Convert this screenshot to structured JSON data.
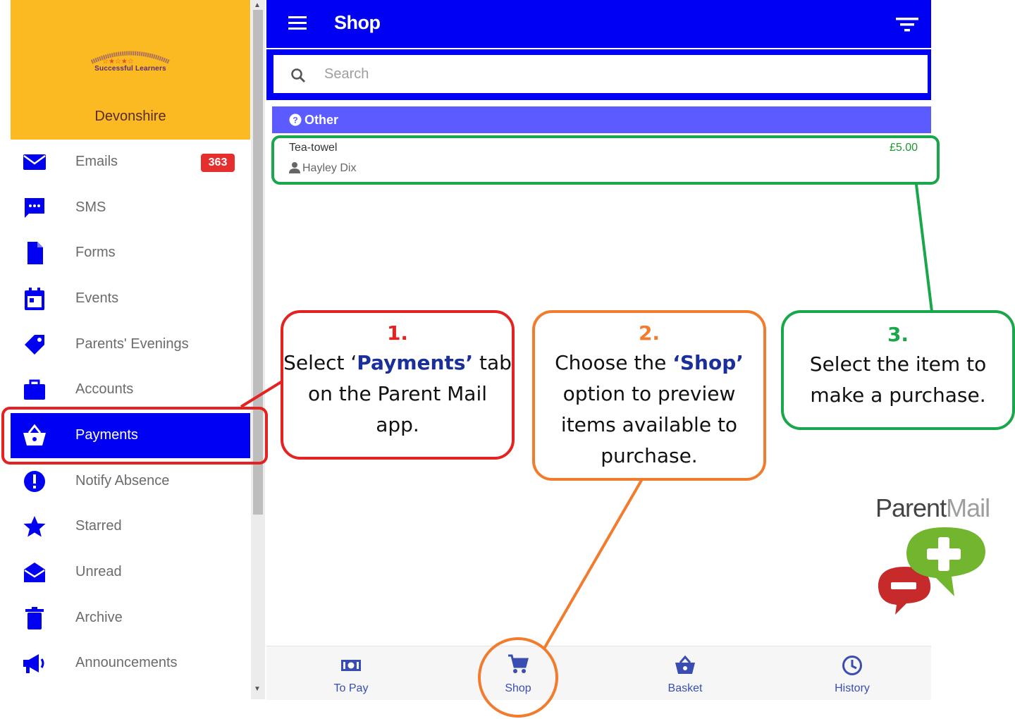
{
  "sidebar": {
    "school": {
      "logo_text": "The Devonshire Hill Nursery & Primary School",
      "motto": "Successful Learners",
      "name": "Devonshire"
    },
    "items": [
      {
        "label": "Emails",
        "icon": "envelope-icon",
        "badge": "363"
      },
      {
        "label": "SMS",
        "icon": "chat-bubble-icon"
      },
      {
        "label": "Forms",
        "icon": "document-icon"
      },
      {
        "label": "Events",
        "icon": "calendar-icon"
      },
      {
        "label": "Parents' Evenings",
        "icon": "tag-icon"
      },
      {
        "label": "Accounts",
        "icon": "briefcase-icon"
      },
      {
        "label": "Payments",
        "icon": "basket-icon",
        "active": true
      },
      {
        "label": "Notify Absence",
        "icon": "alert-circle-icon"
      },
      {
        "label": "Starred",
        "icon": "star-icon"
      },
      {
        "label": "Unread",
        "icon": "open-envelope-icon"
      },
      {
        "label": "Archive",
        "icon": "trash-icon"
      },
      {
        "label": "Announcements",
        "icon": "megaphone-icon"
      }
    ]
  },
  "header": {
    "title": "Shop"
  },
  "search": {
    "placeholder": "Search"
  },
  "category": {
    "label": "Other"
  },
  "item": {
    "name": "Tea-towel",
    "price": "£5.00",
    "seller": "Hayley Dix"
  },
  "bottom_nav": [
    {
      "label": "To Pay",
      "icon": "money-icon"
    },
    {
      "label": "Shop",
      "icon": "cart-icon"
    },
    {
      "label": "Basket",
      "icon": "basket-icon"
    },
    {
      "label": "History",
      "icon": "clock-icon"
    }
  ],
  "callouts": [
    {
      "num": "1.",
      "pre": "Select ‘",
      "strong": "Payments’",
      "post": " tab on the Parent Mail app."
    },
    {
      "num": "2.",
      "pre": "Choose the ",
      "strong": "‘Shop’",
      "post": " option to preview items available to purchase."
    },
    {
      "num": "3.",
      "text": "Select the item to make a purchase."
    }
  ],
  "brand": {
    "parent": "Parent",
    "mail": "Mail"
  },
  "colors": {
    "primary": "#0000f2",
    "category": "#5b5bff",
    "sidebar_header": "#fbb922",
    "badge": "#e52e2e",
    "callout_1": "#e32222",
    "callout_2": "#f27c2e",
    "callout_3": "#1aa64a"
  }
}
